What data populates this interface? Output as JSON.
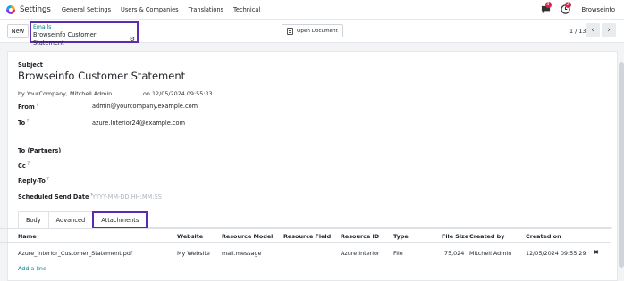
{
  "navbar": {
    "app_name": "Settings",
    "menu": [
      "General Settings",
      "Users & Companies",
      "Translations",
      "Technical"
    ],
    "messages_count": "3",
    "activities_count": "2",
    "company": "Browseinfo"
  },
  "control_panel": {
    "new_label": "New",
    "breadcrumb_parent": "Emails",
    "breadcrumb_current": "Browseinfo Customer Statement",
    "open_document_label": "Open Document",
    "pager": "1 / 13"
  },
  "form": {
    "subject_label": "Subject",
    "subject": "Browseinfo Customer Statement",
    "author": "by YourCompany, Mitchell Admin",
    "date": "on 12/05/2024 09:55:33",
    "from_label": "From",
    "from_value": "admin@yourcompany.example.com",
    "to_label": "To",
    "to_value": "azure.Interior24@example.com",
    "to_partners_label": "To (Partners)",
    "cc_label": "Cc",
    "reply_to_label": "Reply-To",
    "scheduled_label": "Scheduled Send Date",
    "scheduled_placeholder": "YYYY-MM-DD HH:MM:SS"
  },
  "tabs": [
    "Body",
    "Advanced",
    "Attachments"
  ],
  "table": {
    "headers": [
      "Name",
      "Website",
      "Resource Model",
      "Resource Field",
      "Resource ID",
      "Type",
      "File Size",
      "Created by",
      "Created on"
    ],
    "rows": [
      [
        "Azure_Interior_Customer_Statement.pdf",
        "My Website",
        "mail.message",
        "",
        "Azure Interior",
        "File",
        "75,024",
        "Mitchell Admin",
        "12/05/2024 09:55:29"
      ]
    ],
    "add_line": "Add a line"
  },
  "colors": {
    "accent": "#017e84",
    "highlight": "#5b2bb5",
    "badge": "#d9254a"
  }
}
